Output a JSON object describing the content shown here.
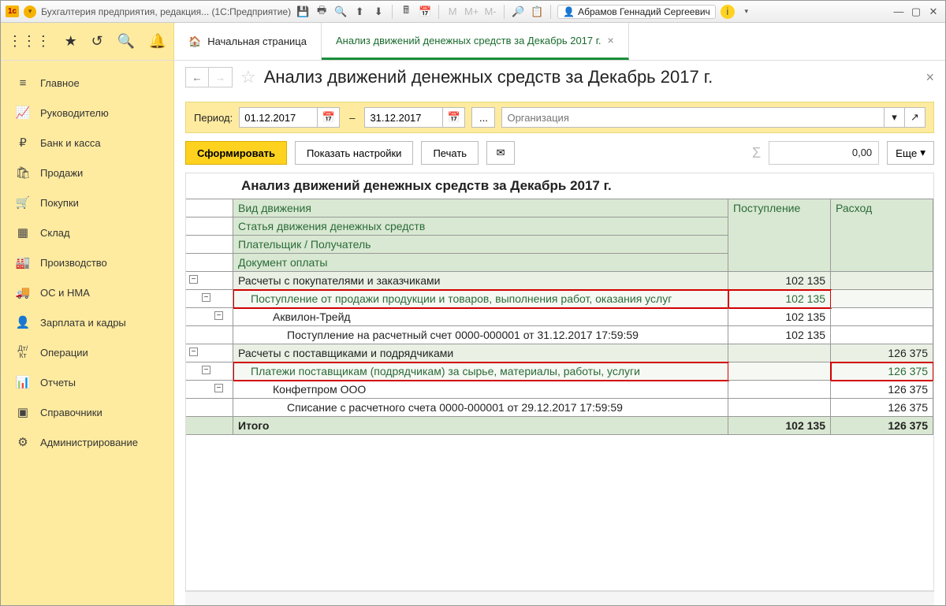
{
  "titlebar": {
    "app_title": "Бухгалтерия предприятия, редакция... (1С:Предприятие)",
    "user": "Абрамов Геннадий Сергеевич"
  },
  "tabs": {
    "home": "Начальная страница",
    "active": "Анализ движений денежных средств за Декабрь 2017 г."
  },
  "sidebar": [
    {
      "icon": "≡",
      "label": "Главное"
    },
    {
      "icon": "📈",
      "label": "Руководителю"
    },
    {
      "icon": "₽",
      "label": "Банк и касса"
    },
    {
      "icon": "🛍",
      "label": "Продажи"
    },
    {
      "icon": "🛒",
      "label": "Покупки"
    },
    {
      "icon": "▦",
      "label": "Склад"
    },
    {
      "icon": "🏭",
      "label": "Производство"
    },
    {
      "icon": "🚚",
      "label": "ОС и НМА"
    },
    {
      "icon": "👤",
      "label": "Зарплата и кадры"
    },
    {
      "icon": "Дт/Кт",
      "label": "Операции"
    },
    {
      "icon": "📊",
      "label": "Отчеты"
    },
    {
      "icon": "▣",
      "label": "Справочники"
    },
    {
      "icon": "⚙",
      "label": "Администрирование"
    }
  ],
  "page": {
    "title": "Анализ движений денежных средств за Декабрь 2017 г."
  },
  "period": {
    "label": "Период:",
    "from": "01.12.2017",
    "to": "31.12.2017",
    "org_placeholder": "Организация"
  },
  "actions": {
    "run": "Сформировать",
    "settings": "Показать настройки",
    "print": "Печать",
    "sum_value": "0,00",
    "more": "Еще"
  },
  "report": {
    "title": "Анализ движений денежных средств за Декабрь 2017 г.",
    "headers": {
      "c1a": "Вид движения",
      "c1b": "Статья движения денежных средств",
      "c1c": "Плательщик / Получатель",
      "c1d": "Документ оплаты",
      "c2": "Поступление",
      "c3": "Расход"
    },
    "rows": [
      {
        "type": "group",
        "text": "Расчеты с покупателями и заказчиками",
        "in": "102 135",
        "out": ""
      },
      {
        "type": "sub",
        "red": true,
        "text": "Поступление от продажи продукции и товаров, выполнения работ, оказания услуг",
        "in": "102 135",
        "out": ""
      },
      {
        "type": "party",
        "text": "Аквилон-Трейд",
        "in": "102 135",
        "out": ""
      },
      {
        "type": "doc",
        "text": "Поступление на расчетный счет 0000-000001 от 31.12.2017 17:59:59",
        "in": "102 135",
        "out": ""
      },
      {
        "type": "group",
        "text": "Расчеты с поставщиками и подрядчиками",
        "in": "",
        "out": "126 375"
      },
      {
        "type": "sub",
        "red": true,
        "text": "Платежи поставщикам (подрядчикам) за сырье, материалы, работы, услуги",
        "in": "",
        "out": "126 375"
      },
      {
        "type": "party",
        "text": "Конфетпром ООО",
        "in": "",
        "out": "126 375"
      },
      {
        "type": "doc",
        "text": "Списание с расчетного счета 0000-000001 от 29.12.2017 17:59:59",
        "in": "",
        "out": "126 375"
      }
    ],
    "total": {
      "label": "Итого",
      "in": "102 135",
      "out": "126 375"
    }
  }
}
